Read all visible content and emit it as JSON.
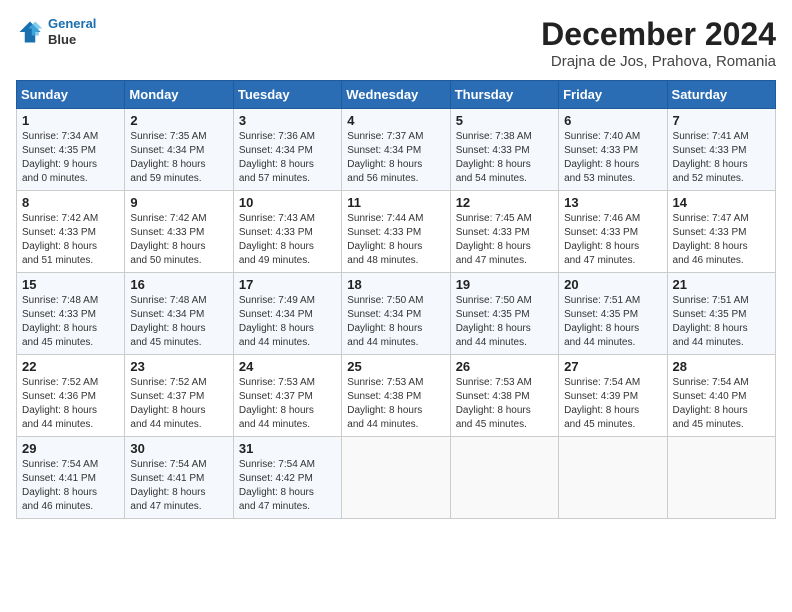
{
  "header": {
    "logo_line1": "General",
    "logo_line2": "Blue",
    "title": "December 2024",
    "location": "Drajna de Jos, Prahova, Romania"
  },
  "weekdays": [
    "Sunday",
    "Monday",
    "Tuesday",
    "Wednesday",
    "Thursday",
    "Friday",
    "Saturday"
  ],
  "weeks": [
    [
      {
        "day": "1",
        "info": "Sunrise: 7:34 AM\nSunset: 4:35 PM\nDaylight: 9 hours\nand 0 minutes."
      },
      {
        "day": "2",
        "info": "Sunrise: 7:35 AM\nSunset: 4:34 PM\nDaylight: 8 hours\nand 59 minutes."
      },
      {
        "day": "3",
        "info": "Sunrise: 7:36 AM\nSunset: 4:34 PM\nDaylight: 8 hours\nand 57 minutes."
      },
      {
        "day": "4",
        "info": "Sunrise: 7:37 AM\nSunset: 4:34 PM\nDaylight: 8 hours\nand 56 minutes."
      },
      {
        "day": "5",
        "info": "Sunrise: 7:38 AM\nSunset: 4:33 PM\nDaylight: 8 hours\nand 54 minutes."
      },
      {
        "day": "6",
        "info": "Sunrise: 7:40 AM\nSunset: 4:33 PM\nDaylight: 8 hours\nand 53 minutes."
      },
      {
        "day": "7",
        "info": "Sunrise: 7:41 AM\nSunset: 4:33 PM\nDaylight: 8 hours\nand 52 minutes."
      }
    ],
    [
      {
        "day": "8",
        "info": "Sunrise: 7:42 AM\nSunset: 4:33 PM\nDaylight: 8 hours\nand 51 minutes."
      },
      {
        "day": "9",
        "info": "Sunrise: 7:42 AM\nSunset: 4:33 PM\nDaylight: 8 hours\nand 50 minutes."
      },
      {
        "day": "10",
        "info": "Sunrise: 7:43 AM\nSunset: 4:33 PM\nDaylight: 8 hours\nand 49 minutes."
      },
      {
        "day": "11",
        "info": "Sunrise: 7:44 AM\nSunset: 4:33 PM\nDaylight: 8 hours\nand 48 minutes."
      },
      {
        "day": "12",
        "info": "Sunrise: 7:45 AM\nSunset: 4:33 PM\nDaylight: 8 hours\nand 47 minutes."
      },
      {
        "day": "13",
        "info": "Sunrise: 7:46 AM\nSunset: 4:33 PM\nDaylight: 8 hours\nand 47 minutes."
      },
      {
        "day": "14",
        "info": "Sunrise: 7:47 AM\nSunset: 4:33 PM\nDaylight: 8 hours\nand 46 minutes."
      }
    ],
    [
      {
        "day": "15",
        "info": "Sunrise: 7:48 AM\nSunset: 4:33 PM\nDaylight: 8 hours\nand 45 minutes."
      },
      {
        "day": "16",
        "info": "Sunrise: 7:48 AM\nSunset: 4:34 PM\nDaylight: 8 hours\nand 45 minutes."
      },
      {
        "day": "17",
        "info": "Sunrise: 7:49 AM\nSunset: 4:34 PM\nDaylight: 8 hours\nand 44 minutes."
      },
      {
        "day": "18",
        "info": "Sunrise: 7:50 AM\nSunset: 4:34 PM\nDaylight: 8 hours\nand 44 minutes."
      },
      {
        "day": "19",
        "info": "Sunrise: 7:50 AM\nSunset: 4:35 PM\nDaylight: 8 hours\nand 44 minutes."
      },
      {
        "day": "20",
        "info": "Sunrise: 7:51 AM\nSunset: 4:35 PM\nDaylight: 8 hours\nand 44 minutes."
      },
      {
        "day": "21",
        "info": "Sunrise: 7:51 AM\nSunset: 4:35 PM\nDaylight: 8 hours\nand 44 minutes."
      }
    ],
    [
      {
        "day": "22",
        "info": "Sunrise: 7:52 AM\nSunset: 4:36 PM\nDaylight: 8 hours\nand 44 minutes."
      },
      {
        "day": "23",
        "info": "Sunrise: 7:52 AM\nSunset: 4:37 PM\nDaylight: 8 hours\nand 44 minutes."
      },
      {
        "day": "24",
        "info": "Sunrise: 7:53 AM\nSunset: 4:37 PM\nDaylight: 8 hours\nand 44 minutes."
      },
      {
        "day": "25",
        "info": "Sunrise: 7:53 AM\nSunset: 4:38 PM\nDaylight: 8 hours\nand 44 minutes."
      },
      {
        "day": "26",
        "info": "Sunrise: 7:53 AM\nSunset: 4:38 PM\nDaylight: 8 hours\nand 45 minutes."
      },
      {
        "day": "27",
        "info": "Sunrise: 7:54 AM\nSunset: 4:39 PM\nDaylight: 8 hours\nand 45 minutes."
      },
      {
        "day": "28",
        "info": "Sunrise: 7:54 AM\nSunset: 4:40 PM\nDaylight: 8 hours\nand 45 minutes."
      }
    ],
    [
      {
        "day": "29",
        "info": "Sunrise: 7:54 AM\nSunset: 4:41 PM\nDaylight: 8 hours\nand 46 minutes."
      },
      {
        "day": "30",
        "info": "Sunrise: 7:54 AM\nSunset: 4:41 PM\nDaylight: 8 hours\nand 47 minutes."
      },
      {
        "day": "31",
        "info": "Sunrise: 7:54 AM\nSunset: 4:42 PM\nDaylight: 8 hours\nand 47 minutes."
      },
      {
        "day": "",
        "info": ""
      },
      {
        "day": "",
        "info": ""
      },
      {
        "day": "",
        "info": ""
      },
      {
        "day": "",
        "info": ""
      }
    ]
  ]
}
